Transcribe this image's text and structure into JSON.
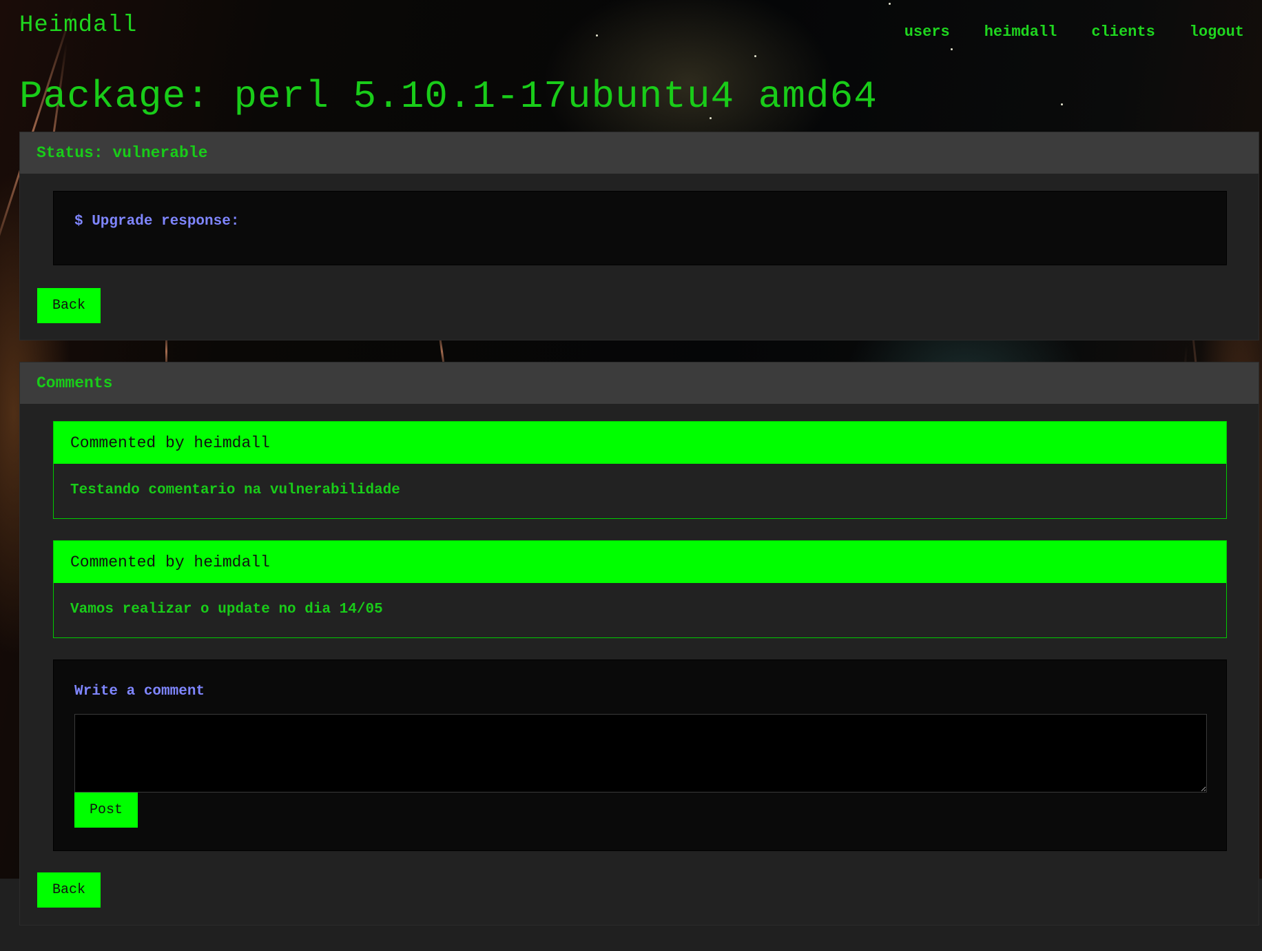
{
  "header": {
    "brand": "Heimdall",
    "nav": [
      "users",
      "heimdall",
      "clients",
      "logout"
    ]
  },
  "page": {
    "title": "Package: perl 5.10.1-17ubuntu4 amd64"
  },
  "status_panel": {
    "heading": "Status: vulnerable",
    "console_text": "$ Upgrade response:",
    "back_label": "Back"
  },
  "comments_panel": {
    "heading": "Comments",
    "comments": [
      {
        "author_line": "Commented by heimdall",
        "body": "Testando comentario na vulnerabilidade"
      },
      {
        "author_line": "Commented by heimdall",
        "body": "Vamos realizar o update no dia 14/05"
      }
    ],
    "write_label": "Write a comment",
    "input_value": "",
    "post_label": "Post",
    "back_label": "Back"
  },
  "colors": {
    "accent_green": "#00ff00",
    "text_green": "#19cc19",
    "console_blue": "#7f86ff",
    "panel_bg": "#222222",
    "panel_head_bg": "#3c3c3c"
  }
}
